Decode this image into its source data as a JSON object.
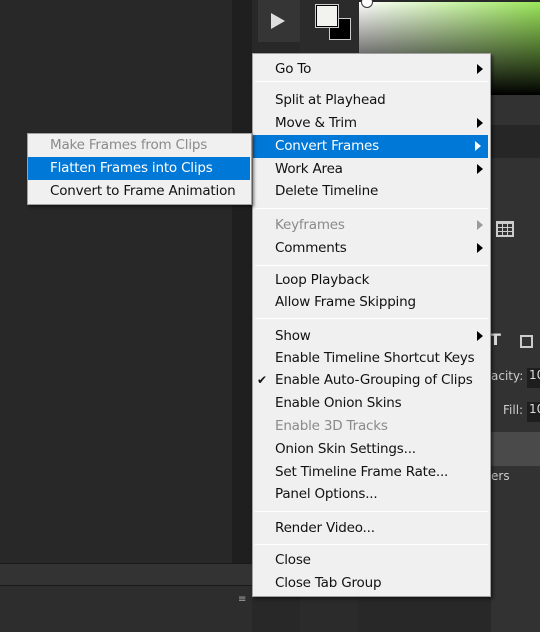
{
  "colors": {
    "menu_bg": "#f0f0f0",
    "highlight": "#0078d7",
    "panel_bg": "#282828"
  },
  "menu": {
    "items": [
      {
        "label": "Go To",
        "submenu": true
      },
      {
        "label": "Split at Playhead"
      },
      {
        "label": "Move & Trim",
        "submenu": true
      },
      {
        "label": "Convert Frames",
        "submenu": true,
        "highlighted": true
      },
      {
        "label": "Work Area",
        "submenu": true
      },
      {
        "label": "Delete Timeline"
      },
      {
        "label": "Keyframes",
        "submenu": true,
        "disabled": true
      },
      {
        "label": "Comments",
        "submenu": true
      },
      {
        "label": "Loop Playback"
      },
      {
        "label": "Allow Frame Skipping"
      },
      {
        "label": "Show",
        "submenu": true
      },
      {
        "label": "Enable Timeline Shortcut Keys"
      },
      {
        "label": "Enable Auto-Grouping of Clips",
        "checked": true
      },
      {
        "label": "Enable Onion Skins"
      },
      {
        "label": "Enable 3D Tracks",
        "disabled": true
      },
      {
        "label": "Onion Skin Settings..."
      },
      {
        "label": "Set Timeline Frame Rate..."
      },
      {
        "label": "Panel Options..."
      },
      {
        "label": "Render Video..."
      },
      {
        "label": "Close"
      },
      {
        "label": "Close Tab Group"
      }
    ]
  },
  "submenu": {
    "items": [
      {
        "label": "Make Frames from Clips",
        "disabled": true
      },
      {
        "label": "Flatten Frames into Clips",
        "highlighted": true
      },
      {
        "label": "Convert to Frame Animation"
      }
    ]
  },
  "background": {
    "opacity_label": "acity:",
    "opacity_value": "10",
    "fill_label": "Fill:",
    "fill_value": "10",
    "layers_partial": "ers"
  }
}
